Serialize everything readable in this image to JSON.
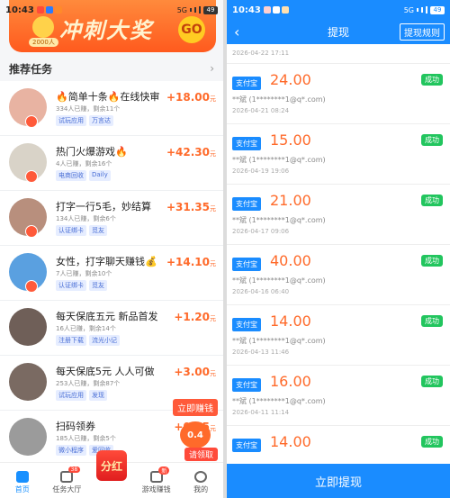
{
  "left": {
    "status": {
      "time": "10:43",
      "net": "5G",
      "battery": "49"
    },
    "banner": {
      "title": "冲刺大奖",
      "pill": "2000人",
      "go": "GO"
    },
    "section": {
      "title": "推荐任务",
      "chevron": "›"
    },
    "tasks": [
      {
        "title": "🔥简单十条🔥在线快审",
        "sub": "334人已赚，剩余11个",
        "tags": [
          "试玩应用",
          "万言达"
        ],
        "reward": "+18.00",
        "unit": "元",
        "av": "#e8b3a2"
      },
      {
        "title": "热门火爆游戏🔥",
        "sub": "4人已赚，剩余16个",
        "tags": [
          "电商回收",
          "Daily"
        ],
        "reward": "+42.30",
        "unit": "元",
        "av": "#d9d3c8"
      },
      {
        "title": "打字一行5毛，妙结算",
        "sub": "134人已赚，剩余6个",
        "tags": [
          "认证绑卡",
          "觅友"
        ],
        "reward": "+31.35",
        "unit": "元",
        "av": "#b88f7d"
      },
      {
        "title": "女性，打字聊天赚钱💰",
        "sub": "7人已赚，剩余10个",
        "tags": [
          "认证绑卡",
          "觅友"
        ],
        "reward": "+14.10",
        "unit": "元",
        "av": "#5aa0e0"
      },
      {
        "title": "每天保底五元 新品首发",
        "sub": "16人已赚，剩余14个",
        "tags": [
          "注册下载",
          "流光小记"
        ],
        "reward": "+1.20",
        "unit": "元",
        "av": "#6f5f58"
      },
      {
        "title": "每天保底5元 人人可做",
        "sub": "253人已赚，剩余87个",
        "tags": [
          "试玩应用",
          "发现"
        ],
        "reward": "+3.00",
        "unit": "元",
        "av": "#7a6a62"
      },
      {
        "title": "扫码领券",
        "sub": "185人已赚，剩余5个",
        "tags": [
          "微小程序",
          "爱回收"
        ],
        "reward": "+0.45",
        "unit": "元",
        "av": "#9b9b9b"
      }
    ],
    "floating": {
      "button": "立即赚钱",
      "alarm": "0.4",
      "get": "请领取"
    },
    "tabs": [
      {
        "label": "首页",
        "badge": ""
      },
      {
        "label": "任务大厅",
        "badge": "38"
      },
      {
        "label": "分红",
        "badge": ""
      },
      {
        "label": "游戏赚钱",
        "badge": "新"
      },
      {
        "label": "我的",
        "badge": ""
      }
    ]
  },
  "right": {
    "status": {
      "time": "10:43",
      "net": "5G",
      "battery": "49"
    },
    "nav": {
      "title": "提现",
      "rules": "提现规则",
      "back": "‹"
    },
    "top_date": "2026-04-22 17:11",
    "method": "支付宝",
    "records": [
      {
        "amount": "24.00",
        "status": "成功",
        "account": "**斌 (1********1@q*.com)",
        "date": "2026-04-21 08:24"
      },
      {
        "amount": "15.00",
        "status": "成功",
        "account": "**斌 (1********1@q*.com)",
        "date": "2026-04-19 19:06"
      },
      {
        "amount": "21.00",
        "status": "成功",
        "account": "**斌 (1********1@q*.com)",
        "date": "2026-04-17 09:06"
      },
      {
        "amount": "40.00",
        "status": "成功",
        "account": "**斌 (1********1@q*.com)",
        "date": "2026-04-16 06:40"
      },
      {
        "amount": "14.00",
        "status": "成功",
        "account": "**斌 (1********1@q*.com)",
        "date": "2026-04-13 11:46"
      },
      {
        "amount": "16.00",
        "status": "成功",
        "account": "**斌 (1********1@q*.com)",
        "date": "2026-04-11 11:14"
      },
      {
        "amount": "14.00",
        "status": "成功",
        "account": "",
        "date": ""
      }
    ],
    "withdraw_button": "立即提现"
  }
}
